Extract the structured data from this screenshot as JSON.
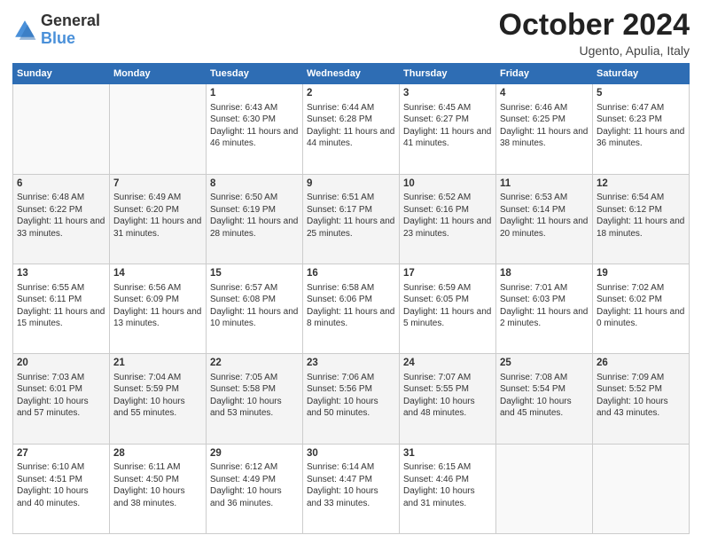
{
  "header": {
    "logo_general": "General",
    "logo_blue": "Blue",
    "month": "October 2024",
    "location": "Ugento, Apulia, Italy"
  },
  "weekdays": [
    "Sunday",
    "Monday",
    "Tuesday",
    "Wednesday",
    "Thursday",
    "Friday",
    "Saturday"
  ],
  "weeks": [
    [
      {
        "day": "",
        "sunrise": "",
        "sunset": "",
        "daylight": ""
      },
      {
        "day": "",
        "sunrise": "",
        "sunset": "",
        "daylight": ""
      },
      {
        "day": "1",
        "sunrise": "Sunrise: 6:43 AM",
        "sunset": "Sunset: 6:30 PM",
        "daylight": "Daylight: 11 hours and 46 minutes."
      },
      {
        "day": "2",
        "sunrise": "Sunrise: 6:44 AM",
        "sunset": "Sunset: 6:28 PM",
        "daylight": "Daylight: 11 hours and 44 minutes."
      },
      {
        "day": "3",
        "sunrise": "Sunrise: 6:45 AM",
        "sunset": "Sunset: 6:27 PM",
        "daylight": "Daylight: 11 hours and 41 minutes."
      },
      {
        "day": "4",
        "sunrise": "Sunrise: 6:46 AM",
        "sunset": "Sunset: 6:25 PM",
        "daylight": "Daylight: 11 hours and 38 minutes."
      },
      {
        "day": "5",
        "sunrise": "Sunrise: 6:47 AM",
        "sunset": "Sunset: 6:23 PM",
        "daylight": "Daylight: 11 hours and 36 minutes."
      }
    ],
    [
      {
        "day": "6",
        "sunrise": "Sunrise: 6:48 AM",
        "sunset": "Sunset: 6:22 PM",
        "daylight": "Daylight: 11 hours and 33 minutes."
      },
      {
        "day": "7",
        "sunrise": "Sunrise: 6:49 AM",
        "sunset": "Sunset: 6:20 PM",
        "daylight": "Daylight: 11 hours and 31 minutes."
      },
      {
        "day": "8",
        "sunrise": "Sunrise: 6:50 AM",
        "sunset": "Sunset: 6:19 PM",
        "daylight": "Daylight: 11 hours and 28 minutes."
      },
      {
        "day": "9",
        "sunrise": "Sunrise: 6:51 AM",
        "sunset": "Sunset: 6:17 PM",
        "daylight": "Daylight: 11 hours and 25 minutes."
      },
      {
        "day": "10",
        "sunrise": "Sunrise: 6:52 AM",
        "sunset": "Sunset: 6:16 PM",
        "daylight": "Daylight: 11 hours and 23 minutes."
      },
      {
        "day": "11",
        "sunrise": "Sunrise: 6:53 AM",
        "sunset": "Sunset: 6:14 PM",
        "daylight": "Daylight: 11 hours and 20 minutes."
      },
      {
        "day": "12",
        "sunrise": "Sunrise: 6:54 AM",
        "sunset": "Sunset: 6:12 PM",
        "daylight": "Daylight: 11 hours and 18 minutes."
      }
    ],
    [
      {
        "day": "13",
        "sunrise": "Sunrise: 6:55 AM",
        "sunset": "Sunset: 6:11 PM",
        "daylight": "Daylight: 11 hours and 15 minutes."
      },
      {
        "day": "14",
        "sunrise": "Sunrise: 6:56 AM",
        "sunset": "Sunset: 6:09 PM",
        "daylight": "Daylight: 11 hours and 13 minutes."
      },
      {
        "day": "15",
        "sunrise": "Sunrise: 6:57 AM",
        "sunset": "Sunset: 6:08 PM",
        "daylight": "Daylight: 11 hours and 10 minutes."
      },
      {
        "day": "16",
        "sunrise": "Sunrise: 6:58 AM",
        "sunset": "Sunset: 6:06 PM",
        "daylight": "Daylight: 11 hours and 8 minutes."
      },
      {
        "day": "17",
        "sunrise": "Sunrise: 6:59 AM",
        "sunset": "Sunset: 6:05 PM",
        "daylight": "Daylight: 11 hours and 5 minutes."
      },
      {
        "day": "18",
        "sunrise": "Sunrise: 7:01 AM",
        "sunset": "Sunset: 6:03 PM",
        "daylight": "Daylight: 11 hours and 2 minutes."
      },
      {
        "day": "19",
        "sunrise": "Sunrise: 7:02 AM",
        "sunset": "Sunset: 6:02 PM",
        "daylight": "Daylight: 11 hours and 0 minutes."
      }
    ],
    [
      {
        "day": "20",
        "sunrise": "Sunrise: 7:03 AM",
        "sunset": "Sunset: 6:01 PM",
        "daylight": "Daylight: 10 hours and 57 minutes."
      },
      {
        "day": "21",
        "sunrise": "Sunrise: 7:04 AM",
        "sunset": "Sunset: 5:59 PM",
        "daylight": "Daylight: 10 hours and 55 minutes."
      },
      {
        "day": "22",
        "sunrise": "Sunrise: 7:05 AM",
        "sunset": "Sunset: 5:58 PM",
        "daylight": "Daylight: 10 hours and 53 minutes."
      },
      {
        "day": "23",
        "sunrise": "Sunrise: 7:06 AM",
        "sunset": "Sunset: 5:56 PM",
        "daylight": "Daylight: 10 hours and 50 minutes."
      },
      {
        "day": "24",
        "sunrise": "Sunrise: 7:07 AM",
        "sunset": "Sunset: 5:55 PM",
        "daylight": "Daylight: 10 hours and 48 minutes."
      },
      {
        "day": "25",
        "sunrise": "Sunrise: 7:08 AM",
        "sunset": "Sunset: 5:54 PM",
        "daylight": "Daylight: 10 hours and 45 minutes."
      },
      {
        "day": "26",
        "sunrise": "Sunrise: 7:09 AM",
        "sunset": "Sunset: 5:52 PM",
        "daylight": "Daylight: 10 hours and 43 minutes."
      }
    ],
    [
      {
        "day": "27",
        "sunrise": "Sunrise: 6:10 AM",
        "sunset": "Sunset: 4:51 PM",
        "daylight": "Daylight: 10 hours and 40 minutes."
      },
      {
        "day": "28",
        "sunrise": "Sunrise: 6:11 AM",
        "sunset": "Sunset: 4:50 PM",
        "daylight": "Daylight: 10 hours and 38 minutes."
      },
      {
        "day": "29",
        "sunrise": "Sunrise: 6:12 AM",
        "sunset": "Sunset: 4:49 PM",
        "daylight": "Daylight: 10 hours and 36 minutes."
      },
      {
        "day": "30",
        "sunrise": "Sunrise: 6:14 AM",
        "sunset": "Sunset: 4:47 PM",
        "daylight": "Daylight: 10 hours and 33 minutes."
      },
      {
        "day": "31",
        "sunrise": "Sunrise: 6:15 AM",
        "sunset": "Sunset: 4:46 PM",
        "daylight": "Daylight: 10 hours and 31 minutes."
      },
      {
        "day": "",
        "sunrise": "",
        "sunset": "",
        "daylight": ""
      },
      {
        "day": "",
        "sunrise": "",
        "sunset": "",
        "daylight": ""
      }
    ]
  ]
}
